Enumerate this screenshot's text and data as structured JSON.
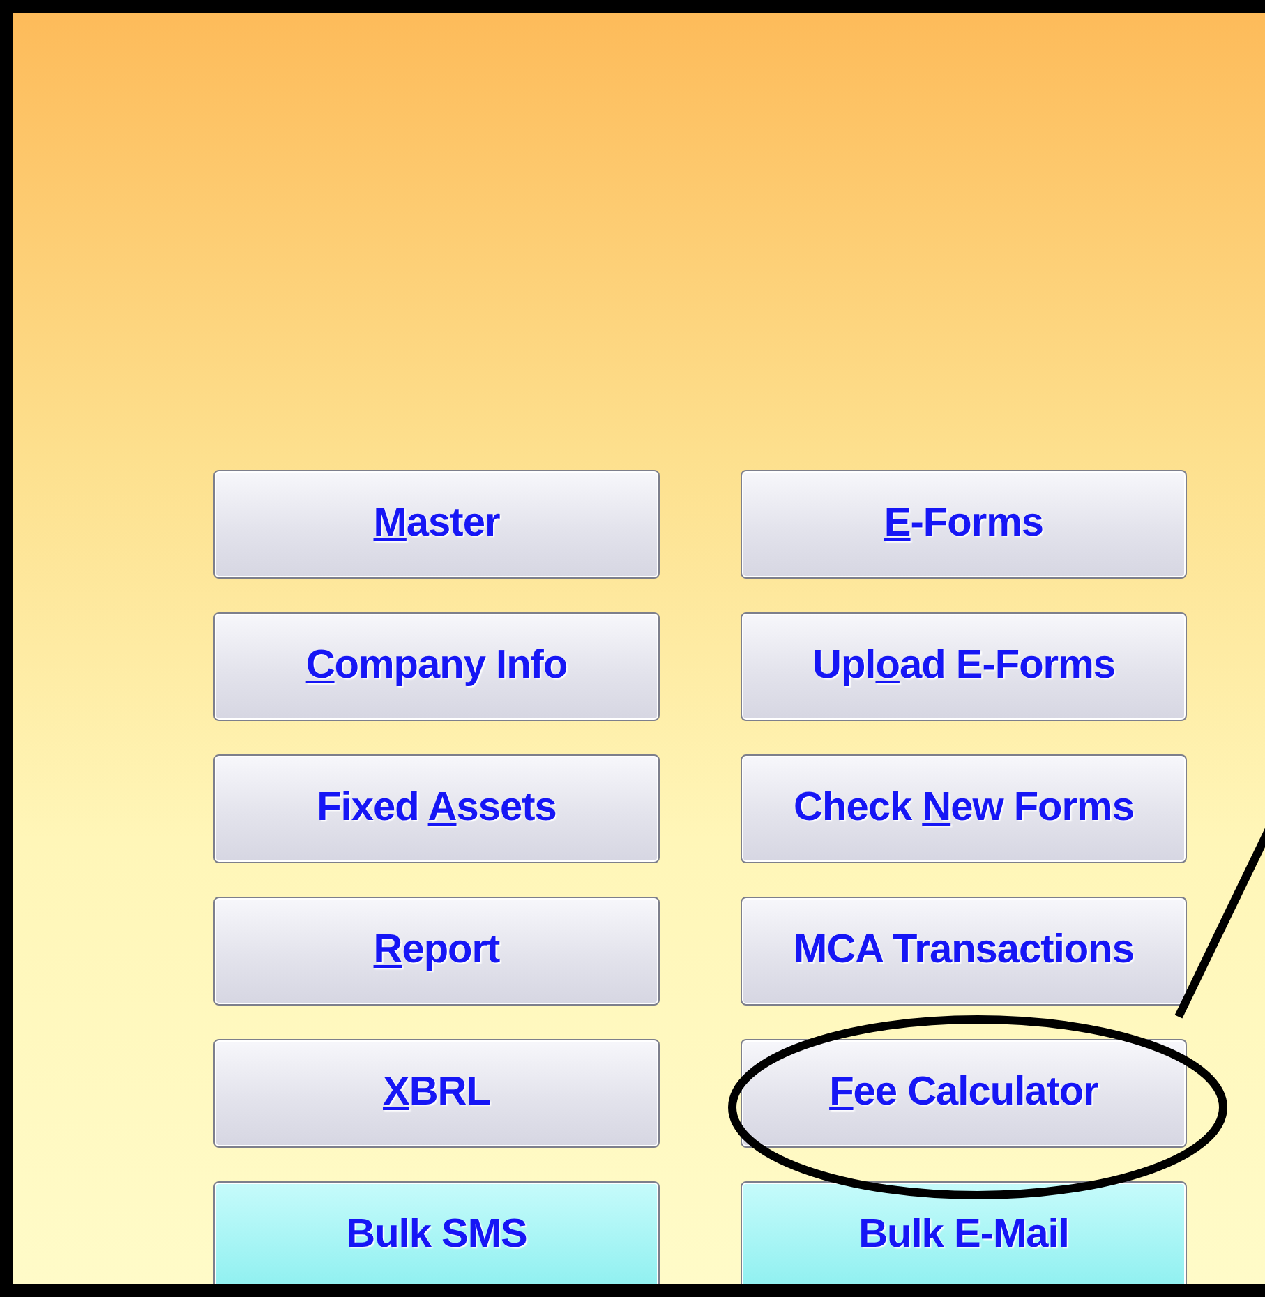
{
  "buttons": [
    {
      "key": "M",
      "after": "aster",
      "kind": "standard"
    },
    {
      "key": "E",
      "after": "-Forms",
      "kind": "standard"
    },
    {
      "key": "C",
      "after": "ompany Info",
      "kind": "standard"
    },
    {
      "before": "Upl",
      "key": "o",
      "after": "ad E-Forms",
      "kind": "standard"
    },
    {
      "before": "Fixed ",
      "key": "A",
      "after": "ssets",
      "kind": "standard"
    },
    {
      "before": "Check ",
      "key": "N",
      "after": "ew Forms",
      "kind": "standard"
    },
    {
      "key": "R",
      "after": "eport",
      "kind": "standard"
    },
    {
      "before": "MCA Transactions",
      "kind": "standard"
    },
    {
      "key": "X",
      "after": "BRL",
      "kind": "standard"
    },
    {
      "key": "F",
      "after": "ee Calculator",
      "kind": "standard"
    },
    {
      "before": "Bulk SMS",
      "kind": "highlight"
    },
    {
      "before": "Bulk E-Mail",
      "kind": "highlight"
    }
  ]
}
